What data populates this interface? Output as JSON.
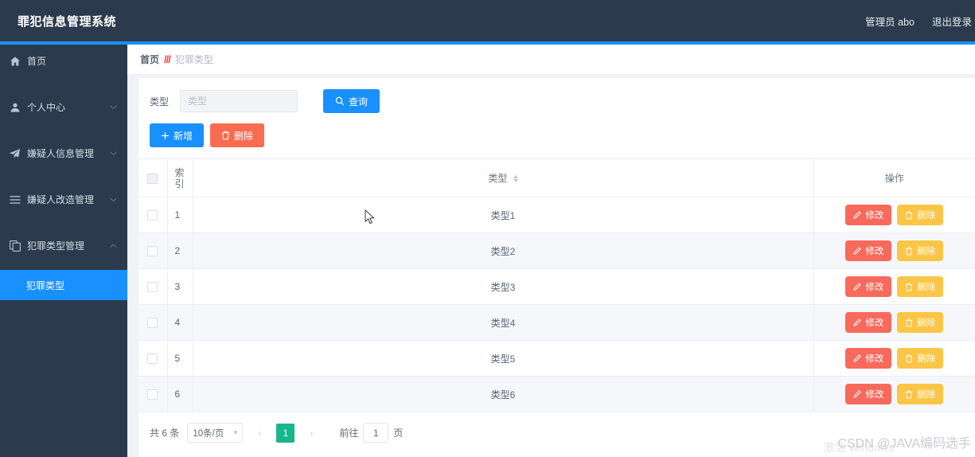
{
  "header": {
    "brand": "罪犯信息管理系统",
    "user": "管理员 abo",
    "logout": "退出登录"
  },
  "sidebar": {
    "items": [
      {
        "label": "首页",
        "icon": "home-icon",
        "expandable": false
      },
      {
        "label": "个人中心",
        "icon": "user-icon",
        "expandable": true
      },
      {
        "label": "嫌疑人信息管理",
        "icon": "send-icon",
        "expandable": true
      },
      {
        "label": "嫌疑人改造管理",
        "icon": "list-icon",
        "expandable": true
      },
      {
        "label": "犯罪类型管理",
        "icon": "copy-icon",
        "expandable": true,
        "expanded": true
      }
    ],
    "subitems": [
      {
        "label": "犯罪类型",
        "active": true
      }
    ]
  },
  "breadcrumb": {
    "home": "首页",
    "separator": "/",
    "current": "犯罪类型"
  },
  "filter": {
    "label": "类型",
    "value": "",
    "placeholder": "类型",
    "query_label": "查询",
    "query_icon": "search-icon"
  },
  "toolbar": {
    "add_label": "新增",
    "add_icon": "plus-icon",
    "delete_label": "删除",
    "delete_icon": "trash-icon"
  },
  "table": {
    "columns": {
      "index": "索引",
      "type": "类型",
      "action": "操作"
    },
    "sortable_column": "类型",
    "rows": [
      {
        "index": "1",
        "type": "类型1"
      },
      {
        "index": "2",
        "type": "类型2"
      },
      {
        "index": "3",
        "type": "类型3"
      },
      {
        "index": "4",
        "type": "类型4"
      },
      {
        "index": "5",
        "type": "类型5"
      },
      {
        "index": "6",
        "type": "类型6"
      }
    ],
    "row_actions": {
      "edit_label": "修改",
      "edit_icon": "pencil-icon",
      "delete_label": "删除",
      "delete_icon": "trash-icon"
    }
  },
  "pagination": {
    "total_text": "共 6 条",
    "page_size": "10条/页",
    "prev_icon": "chevron-left-icon",
    "next_icon": "chevron-right-icon",
    "current_page": "1",
    "jump_prefix": "前往",
    "jump_value": "1",
    "jump_suffix": "页"
  },
  "watermarks": {
    "csdn": "CSDN @JAVA编码选手",
    "windows": "激活 Windows"
  },
  "colors": {
    "header_bg": "#2b3a4d",
    "accent_blue": "#1890ff",
    "edit_red": "#f9695c",
    "delete_orange": "#fbc546",
    "delete_btn_red": "#fa6c51",
    "page_active_green": "#19b58b",
    "breadcrumb_sep_red": "#e8453c"
  }
}
